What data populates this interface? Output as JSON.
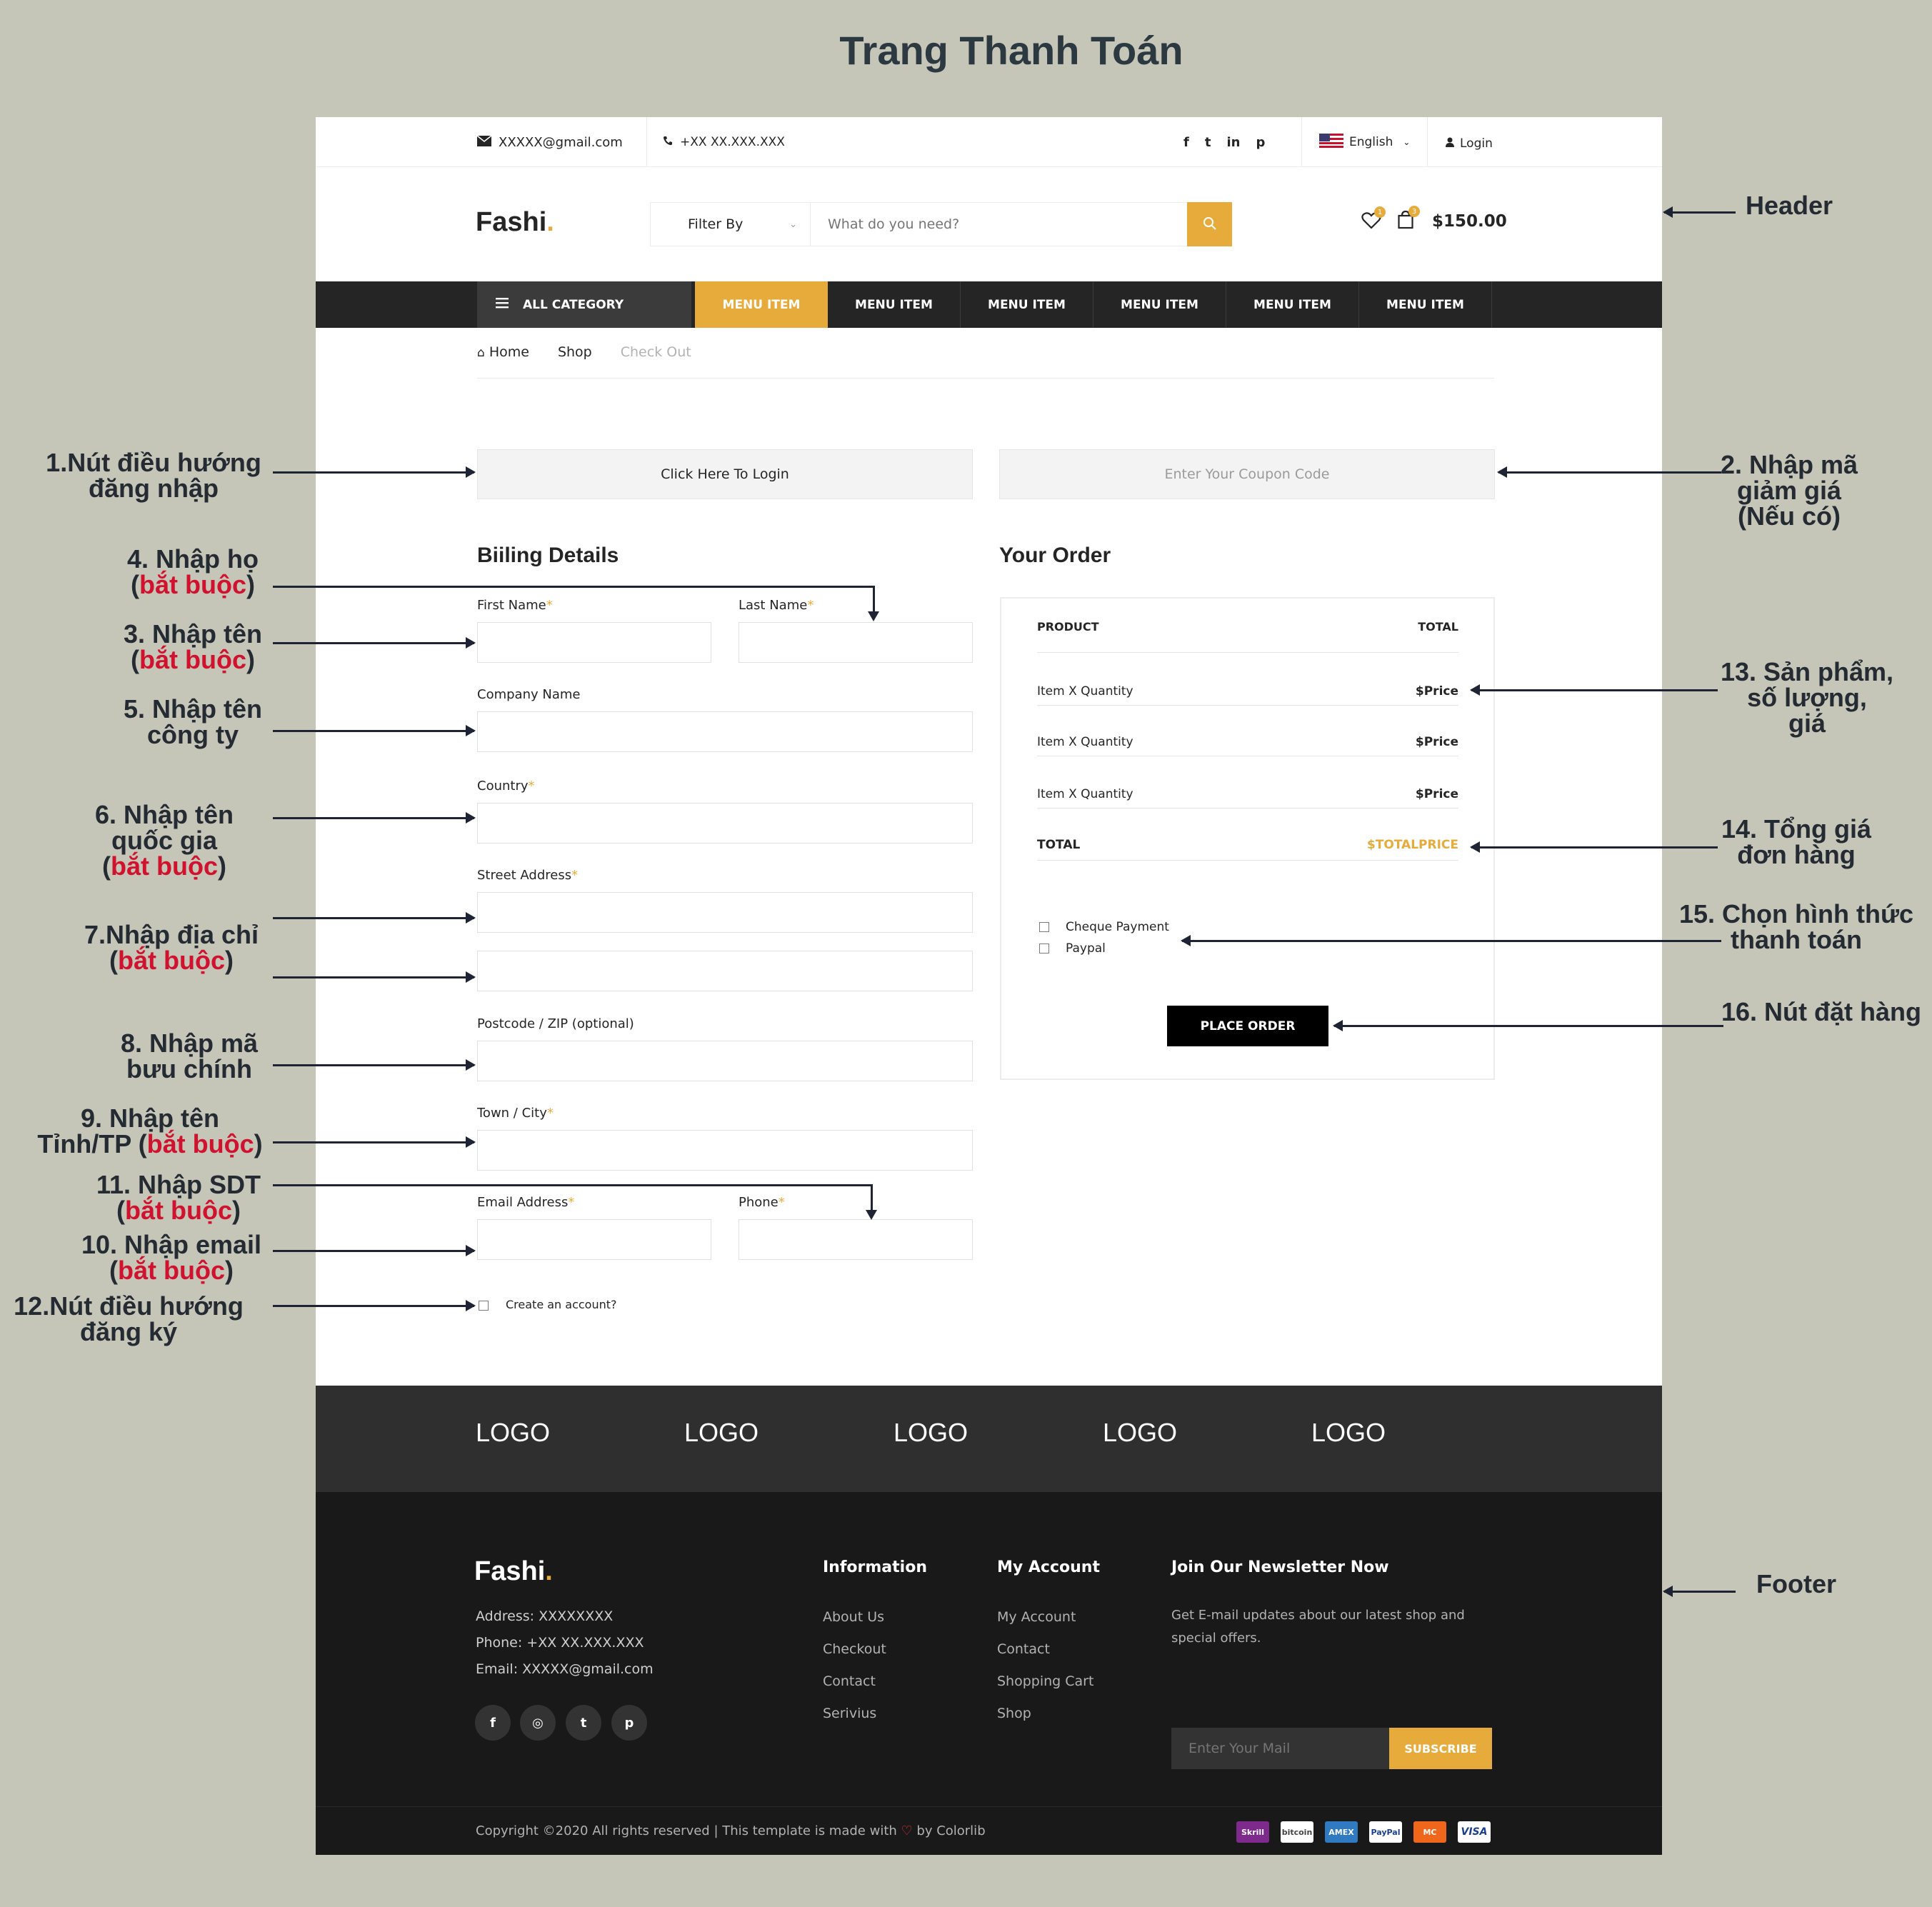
{
  "doc_title": "Trang Thanh Toán",
  "topbar": {
    "email": "XXXXX@gmail.com",
    "phone": "+XX XX.XXX.XXX",
    "social": [
      "f",
      "t",
      "in",
      "p"
    ],
    "language": "English",
    "login": "Login"
  },
  "header": {
    "logo": "Fashi",
    "logo_dot": ".",
    "filter_label": "Filter By",
    "search_placeholder": "What do you need?",
    "wishlist_count": "1",
    "cart_count": "3",
    "cart_total": "$150.00"
  },
  "nav": {
    "all_category": "ALL CATEGORY",
    "menu_items": [
      "MENU ITEM",
      "MENU ITEM",
      "MENU ITEM",
      "MENU ITEM",
      "MENU ITEM",
      "MENU ITEM"
    ]
  },
  "breadcrumb": {
    "home": "Home",
    "shop": "Shop",
    "current": "Check Out"
  },
  "login_prompt": "Click Here To Login",
  "coupon_placeholder": "Enter Your Coupon Code",
  "billing": {
    "title": "Biiling Details",
    "first_name": "First Name",
    "last_name": "Last Name",
    "company": "Company Name",
    "country": "Country",
    "street": "Street Address",
    "postcode": "Postcode / ZIP (optional)",
    "town": "Town / City",
    "email": "Email Address",
    "phone": "Phone",
    "required_mark": "*",
    "create_account": "Create an account?"
  },
  "order": {
    "title": "Your Order",
    "col_product": "PRODUCT",
    "col_total": "TOTAL",
    "items": [
      {
        "name": "Item X Quantity",
        "price": "$Price"
      },
      {
        "name": "Item X Quantity",
        "price": "$Price"
      },
      {
        "name": "Item X Quantity",
        "price": "$Price"
      }
    ],
    "total_label": "TOTAL",
    "total_value": "$TOTALPRICE",
    "payments": [
      "Cheque Payment",
      "Paypal"
    ],
    "place_order": "PLACE ORDER"
  },
  "partners": [
    "LOGO",
    "LOGO",
    "LOGO",
    "LOGO",
    "LOGO"
  ],
  "footer": {
    "logo": "Fashi",
    "logo_dot": ".",
    "address": "Address: XXXXXXXX",
    "phone": "Phone: +XX XX.XXX.XXX",
    "email": "Email: XXXXX@gmail.com",
    "social": [
      "f",
      "◎",
      "t",
      "p"
    ],
    "info_title": "Information",
    "info_links": [
      "About Us",
      "Checkout",
      "Contact",
      "Serivius"
    ],
    "account_title": "My Account",
    "account_links": [
      "My Account",
      "Contact",
      "Shopping Cart",
      "Shop"
    ],
    "newsletter_title": "Join Our Newsletter Now",
    "newsletter_text_1": "Get E-mail updates about our latest shop and",
    "newsletter_text_2": "special offers.",
    "mail_placeholder": "Enter Your Mail",
    "subscribe": "SUBSCRIBE",
    "copyright_1": "Copyright ©2020 All rights reserved | This template is made with",
    "copyright_2": "by Colorlib",
    "payments": [
      "Skrill",
      "bitcoin",
      "AMEX",
      "PayPal",
      "MC",
      "VISA"
    ]
  },
  "annotations": {
    "header": "Header",
    "footer": "Footer",
    "a1_l1": "1.Nút điều hướng",
    "a1_l2": "đăng nhập",
    "a2_l1": "2. Nhập mã",
    "a2_l2": "giảm giá",
    "a2_l3": "(Nếu có)",
    "a4_l1": "4. Nhập họ",
    "a3_l1": "3. Nhập tên",
    "required": "bắt buộc",
    "a5_l1": "5. Nhập tên",
    "a5_l2": "công ty",
    "a6_l1": "6. Nhập tên",
    "a6_l2": "quốc gia",
    "a7_l1": "7.Nhập địa chỉ",
    "a8_l1": "8. Nhập mã",
    "a8_l2": "bưu chính",
    "a9_l1": "9. Nhập tên",
    "a9_l2": "Tỉnh/TP",
    "a11_l1": "11. Nhập SDT",
    "a10_l1": "10. Nhập email",
    "a12_l1": "12.Nút điều hướng",
    "a12_l2": "đăng ký",
    "a13_l1": "13. Sản phẩm,",
    "a13_l2": "số lượng,",
    "a13_l3": "giá",
    "a14_l1": "14. Tổng giá",
    "a14_l2": "đơn hàng",
    "a15_l1": "15. Chọn hình thức",
    "a15_l2": "thanh toán",
    "a16_l1": "16. Nút đặt hàng"
  },
  "colors": {
    "accent": "#e7ab3c",
    "dark": "#252525",
    "footer": "#191919",
    "background": "#c5c5b8",
    "annotation_red": "#d0122e"
  }
}
